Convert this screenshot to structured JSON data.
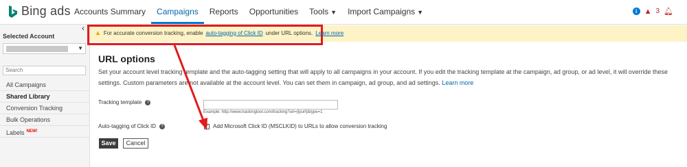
{
  "app": {
    "logo_text": "Bing ads"
  },
  "nav": {
    "items": [
      {
        "label": "Accounts Summary"
      },
      {
        "label": "Campaigns"
      },
      {
        "label": "Reports"
      },
      {
        "label": "Opportunities"
      },
      {
        "label": "Tools"
      },
      {
        "label": "Import Campaigns"
      }
    ],
    "active": "Campaigns",
    "notification_count": "3"
  },
  "sidebar": {
    "selected_account_label": "Selected Account",
    "search_placeholder": "Search",
    "items": [
      {
        "label": "All Campaigns"
      },
      {
        "label": "Shared Library"
      },
      {
        "label": "Conversion Tracking"
      },
      {
        "label": "Bulk Operations"
      },
      {
        "label": "Labels",
        "badge": "NEW!"
      }
    ],
    "active": "Shared Library"
  },
  "banner": {
    "text_before": "For accurate conversion tracking, enable",
    "link": "auto-tagging of Click ID",
    "text_after": "under URL options.",
    "learn_more": "Learn more"
  },
  "page": {
    "title": "URL options",
    "description": "Set your account level tracking template and the auto-tagging setting that will apply to all campaigns in your account. If you edit the tracking template at the campaign, ad group, or ad level, it will override these settings. Custom parameters are not available at the account level. You can set them in campaign, ad group, and ad settings.",
    "learn_more": "Learn more",
    "tracking_template_label": "Tracking template",
    "tracking_template_value": "",
    "example_text": "Example: http://www.trackingtool.com/tracking?url={lpurl}&type=1",
    "auto_tagging_label": "Auto-tagging of Click ID",
    "auto_tagging_checkbox_label": "Add Microsoft Click ID (MSCLKID) to URLs to allow conversion tracking",
    "auto_tagging_checked": true,
    "save_label": "Save",
    "cancel_label": "Cancel"
  },
  "colors": {
    "accent": "#0078d4",
    "banner_bg": "#fdf3c6",
    "highlight_red": "#e21b1b"
  }
}
